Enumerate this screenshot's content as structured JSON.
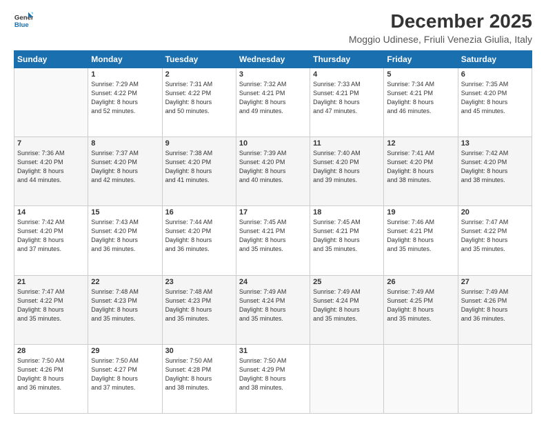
{
  "logo": {
    "line1": "General",
    "line2": "Blue"
  },
  "title": "December 2025",
  "subtitle": "Moggio Udinese, Friuli Venezia Giulia, Italy",
  "days_of_week": [
    "Sunday",
    "Monday",
    "Tuesday",
    "Wednesday",
    "Thursday",
    "Friday",
    "Saturday"
  ],
  "weeks": [
    [
      {
        "day": "",
        "info": ""
      },
      {
        "day": "1",
        "info": "Sunrise: 7:29 AM\nSunset: 4:22 PM\nDaylight: 8 hours\nand 52 minutes."
      },
      {
        "day": "2",
        "info": "Sunrise: 7:31 AM\nSunset: 4:22 PM\nDaylight: 8 hours\nand 50 minutes."
      },
      {
        "day": "3",
        "info": "Sunrise: 7:32 AM\nSunset: 4:21 PM\nDaylight: 8 hours\nand 49 minutes."
      },
      {
        "day": "4",
        "info": "Sunrise: 7:33 AM\nSunset: 4:21 PM\nDaylight: 8 hours\nand 47 minutes."
      },
      {
        "day": "5",
        "info": "Sunrise: 7:34 AM\nSunset: 4:21 PM\nDaylight: 8 hours\nand 46 minutes."
      },
      {
        "day": "6",
        "info": "Sunrise: 7:35 AM\nSunset: 4:20 PM\nDaylight: 8 hours\nand 45 minutes."
      }
    ],
    [
      {
        "day": "7",
        "info": "Sunrise: 7:36 AM\nSunset: 4:20 PM\nDaylight: 8 hours\nand 44 minutes."
      },
      {
        "day": "8",
        "info": "Sunrise: 7:37 AM\nSunset: 4:20 PM\nDaylight: 8 hours\nand 42 minutes."
      },
      {
        "day": "9",
        "info": "Sunrise: 7:38 AM\nSunset: 4:20 PM\nDaylight: 8 hours\nand 41 minutes."
      },
      {
        "day": "10",
        "info": "Sunrise: 7:39 AM\nSunset: 4:20 PM\nDaylight: 8 hours\nand 40 minutes."
      },
      {
        "day": "11",
        "info": "Sunrise: 7:40 AM\nSunset: 4:20 PM\nDaylight: 8 hours\nand 39 minutes."
      },
      {
        "day": "12",
        "info": "Sunrise: 7:41 AM\nSunset: 4:20 PM\nDaylight: 8 hours\nand 38 minutes."
      },
      {
        "day": "13",
        "info": "Sunrise: 7:42 AM\nSunset: 4:20 PM\nDaylight: 8 hours\nand 38 minutes."
      }
    ],
    [
      {
        "day": "14",
        "info": "Sunrise: 7:42 AM\nSunset: 4:20 PM\nDaylight: 8 hours\nand 37 minutes."
      },
      {
        "day": "15",
        "info": "Sunrise: 7:43 AM\nSunset: 4:20 PM\nDaylight: 8 hours\nand 36 minutes."
      },
      {
        "day": "16",
        "info": "Sunrise: 7:44 AM\nSunset: 4:20 PM\nDaylight: 8 hours\nand 36 minutes."
      },
      {
        "day": "17",
        "info": "Sunrise: 7:45 AM\nSunset: 4:21 PM\nDaylight: 8 hours\nand 35 minutes."
      },
      {
        "day": "18",
        "info": "Sunrise: 7:45 AM\nSunset: 4:21 PM\nDaylight: 8 hours\nand 35 minutes."
      },
      {
        "day": "19",
        "info": "Sunrise: 7:46 AM\nSunset: 4:21 PM\nDaylight: 8 hours\nand 35 minutes."
      },
      {
        "day": "20",
        "info": "Sunrise: 7:47 AM\nSunset: 4:22 PM\nDaylight: 8 hours\nand 35 minutes."
      }
    ],
    [
      {
        "day": "21",
        "info": "Sunrise: 7:47 AM\nSunset: 4:22 PM\nDaylight: 8 hours\nand 35 minutes."
      },
      {
        "day": "22",
        "info": "Sunrise: 7:48 AM\nSunset: 4:23 PM\nDaylight: 8 hours\nand 35 minutes."
      },
      {
        "day": "23",
        "info": "Sunrise: 7:48 AM\nSunset: 4:23 PM\nDaylight: 8 hours\nand 35 minutes."
      },
      {
        "day": "24",
        "info": "Sunrise: 7:49 AM\nSunset: 4:24 PM\nDaylight: 8 hours\nand 35 minutes."
      },
      {
        "day": "25",
        "info": "Sunrise: 7:49 AM\nSunset: 4:24 PM\nDaylight: 8 hours\nand 35 minutes."
      },
      {
        "day": "26",
        "info": "Sunrise: 7:49 AM\nSunset: 4:25 PM\nDaylight: 8 hours\nand 35 minutes."
      },
      {
        "day": "27",
        "info": "Sunrise: 7:49 AM\nSunset: 4:26 PM\nDaylight: 8 hours\nand 36 minutes."
      }
    ],
    [
      {
        "day": "28",
        "info": "Sunrise: 7:50 AM\nSunset: 4:26 PM\nDaylight: 8 hours\nand 36 minutes."
      },
      {
        "day": "29",
        "info": "Sunrise: 7:50 AM\nSunset: 4:27 PM\nDaylight: 8 hours\nand 37 minutes."
      },
      {
        "day": "30",
        "info": "Sunrise: 7:50 AM\nSunset: 4:28 PM\nDaylight: 8 hours\nand 38 minutes."
      },
      {
        "day": "31",
        "info": "Sunrise: 7:50 AM\nSunset: 4:29 PM\nDaylight: 8 hours\nand 38 minutes."
      },
      {
        "day": "",
        "info": ""
      },
      {
        "day": "",
        "info": ""
      },
      {
        "day": "",
        "info": ""
      }
    ]
  ]
}
